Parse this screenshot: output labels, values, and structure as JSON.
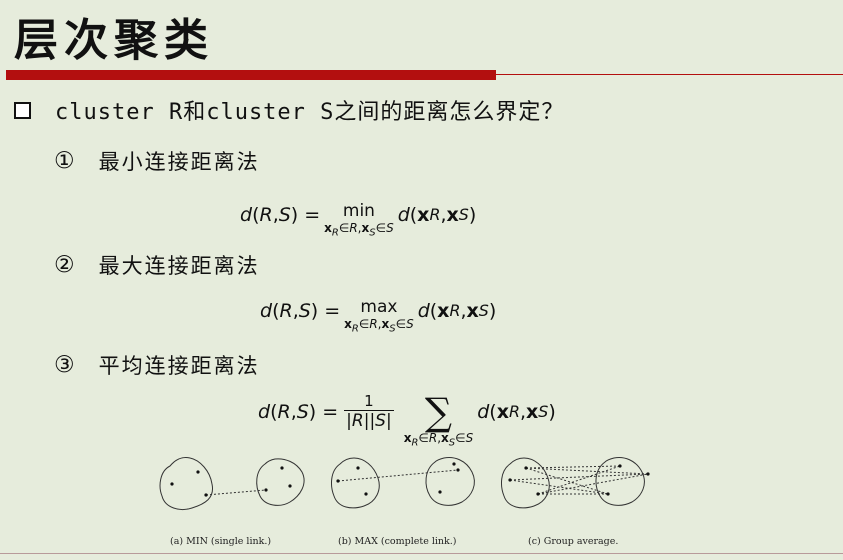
{
  "title": "层次聚类",
  "question": "cluster R和cluster S之间的距离怎么界定？",
  "items": [
    {
      "num": "①",
      "label": "最小连接距离法",
      "op": "min"
    },
    {
      "num": "②",
      "label": "最大连接距离法",
      "op": "max"
    },
    {
      "num": "③",
      "label": "平均连接距离法",
      "numerator": "1",
      "denominator": "|R||S|"
    }
  ],
  "formula": {
    "lhs": "d(R, S) =",
    "rhs": "d(x",
    "subscript": "x_R∈R,x_S∈S"
  },
  "captions": [
    "(a) MIN (single link.)",
    "(b) MAX (complete link.)",
    "(c) Group average."
  ],
  "colors": {
    "background": "#e6ecdc",
    "accent": "#b30f0f"
  }
}
